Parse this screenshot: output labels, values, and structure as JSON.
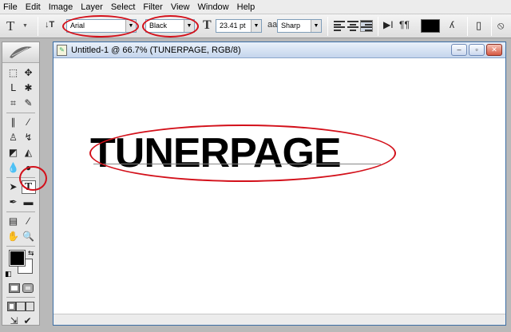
{
  "menu": [
    "File",
    "Edit",
    "Image",
    "Layer",
    "Select",
    "Filter",
    "View",
    "Window",
    "Help"
  ],
  "options_bar": {
    "tool_preset_glyph": "T",
    "font_family": "Arial",
    "font_style": "Black",
    "font_size": "23.41 pt",
    "antialias_label": "aa",
    "antialias": "Sharp",
    "text_color": "#000000",
    "icons": [
      "text-orientation-icon",
      "font-size-icon",
      "align-left-icon",
      "align-center-icon",
      "align-right-icon",
      "warp-text-icon",
      "palettes-icon",
      "cancel-icon"
    ]
  },
  "toolbox": {
    "active_tool": "horizontal-type-tool",
    "active_tool_glyph": "T",
    "foreground_color": "#000000",
    "background_color": "#ffffff"
  },
  "document": {
    "title": "Untitled-1 @ 66.7% (TUNERPAGE, RGB/8)",
    "text_layer": "TUNERPAGE"
  },
  "annotations": {
    "color": "#d3101a",
    "targets": [
      "font-family-select",
      "font-style-select",
      "type-tool",
      "canvas-text"
    ]
  }
}
